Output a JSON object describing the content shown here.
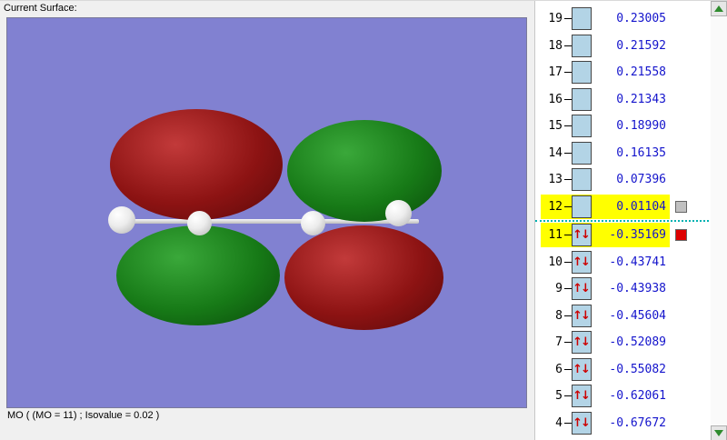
{
  "header": {
    "current_surface_label": "Current Surface:"
  },
  "caption": "MO ( (MO = 11) ; Isovalue = 0.02 )",
  "icons": {
    "spin_up": "↑",
    "spin_down": "↓"
  },
  "colors": {
    "viewport_bg": "#8181d1",
    "lobe_positive": "#8d1313",
    "lobe_negative": "#177a17",
    "highlight": "#ffff00",
    "energy_text": "#1414cc",
    "occupancy_box": "#b3d4e6",
    "spin_arrow": "#cc0000",
    "separator": "#00b2b2",
    "scroll_arrow": "#2e8b2e",
    "swatch_lumo": "#c0c0c0",
    "swatch_homo": "#dd0000"
  },
  "orbital_list": {
    "rows": [
      {
        "num": "19",
        "value": "0.23005",
        "occupied": false,
        "highlight": false
      },
      {
        "num": "18",
        "value": "0.21592",
        "occupied": false,
        "highlight": false
      },
      {
        "num": "17",
        "value": "0.21558",
        "occupied": false,
        "highlight": false
      },
      {
        "num": "16",
        "value": "0.21343",
        "occupied": false,
        "highlight": false
      },
      {
        "num": "15",
        "value": "0.18990",
        "occupied": false,
        "highlight": false
      },
      {
        "num": "14",
        "value": "0.16135",
        "occupied": false,
        "highlight": false
      },
      {
        "num": "13",
        "value": "0.07396",
        "occupied": false,
        "highlight": false
      },
      {
        "num": "12",
        "value": "0.01104",
        "occupied": false,
        "highlight": true,
        "swatch": "#c0c0c0",
        "separator_after": true
      },
      {
        "num": "11",
        "value": "-0.35169",
        "occupied": true,
        "highlight": true,
        "swatch": "#dd0000"
      },
      {
        "num": "10",
        "value": "-0.43741",
        "occupied": true,
        "highlight": false
      },
      {
        "num": "9",
        "value": "-0.43938",
        "occupied": true,
        "highlight": false
      },
      {
        "num": "8",
        "value": "-0.45604",
        "occupied": true,
        "highlight": false
      },
      {
        "num": "7",
        "value": "-0.52089",
        "occupied": true,
        "highlight": false
      },
      {
        "num": "6",
        "value": "-0.55082",
        "occupied": true,
        "highlight": false
      },
      {
        "num": "5",
        "value": "-0.62061",
        "occupied": true,
        "highlight": false
      },
      {
        "num": "4",
        "value": "-0.67672",
        "occupied": true,
        "highlight": false
      }
    ]
  }
}
